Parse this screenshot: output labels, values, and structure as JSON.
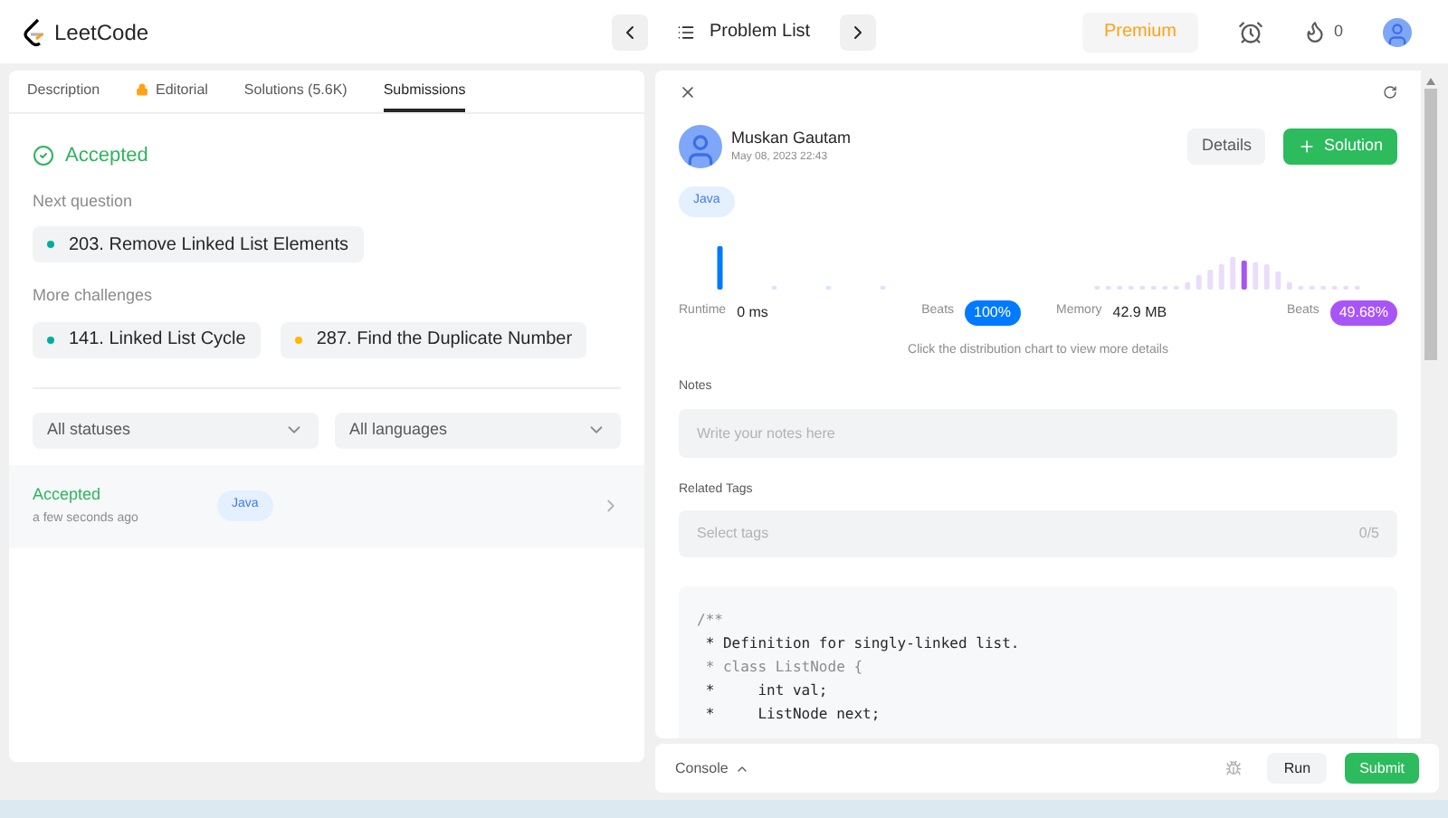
{
  "header": {
    "logo": "LeetCode",
    "problem_list": "Problem List",
    "premium": "Premium",
    "streak": "0"
  },
  "tabs": [
    {
      "label": "Description",
      "selected": false,
      "locked": false
    },
    {
      "label": "Editorial",
      "selected": false,
      "locked": true
    },
    {
      "label": "Solutions (5.6K)",
      "selected": false,
      "locked": false
    },
    {
      "label": "Submissions",
      "selected": true,
      "locked": false
    }
  ],
  "result": {
    "status": "Accepted"
  },
  "next_question": {
    "title": "Next question",
    "items": [
      {
        "label": "203. Remove Linked List Elements",
        "color": "#00af9b"
      }
    ]
  },
  "more_challenges": {
    "title": "More challenges",
    "items": [
      {
        "label": "141. Linked List Cycle",
        "color": "#00af9b"
      },
      {
        "label": "287. Find the Duplicate Number",
        "color": "#ffb800"
      }
    ]
  },
  "filters": [
    {
      "value": "All statuses"
    },
    {
      "value": "All languages"
    }
  ],
  "submissions": [
    {
      "status": "Accepted",
      "time": "a few seconds ago",
      "language": "Java"
    }
  ],
  "detail": {
    "author": "Muskan Gautam",
    "date": "May 08, 2023 22:43",
    "details_button": "Details",
    "solution_button": "Solution",
    "language": "Java",
    "stats": [
      {
        "label": "Runtime",
        "value": "0 ms",
        "beats_label": "Beats",
        "beats": "100%",
        "color": "#007aff"
      },
      {
        "label": "Memory",
        "value": "42.9 MB",
        "beats_label": "Beats",
        "beats": "49.68%",
        "color": "#a855f7"
      }
    ],
    "hint": "Click the distribution chart to view more details",
    "notes": {
      "label": "Notes",
      "placeholder": "Write your notes here"
    },
    "tags": {
      "label": "Related Tags",
      "placeholder": "Select tags",
      "count": "0/5"
    },
    "code": [
      {
        "text": "/**",
        "dim": true
      },
      {
        "text": " * Definition for singly-linked list.",
        "dim": false
      },
      {
        "text": " * class ListNode {",
        "dim": true
      },
      {
        "text": " *     int val;",
        "dim": false
      },
      {
        "text": " *     ListNode next;",
        "dim": false
      }
    ]
  },
  "console": {
    "label": "Console",
    "run": "Run",
    "submit": "Submit"
  }
}
